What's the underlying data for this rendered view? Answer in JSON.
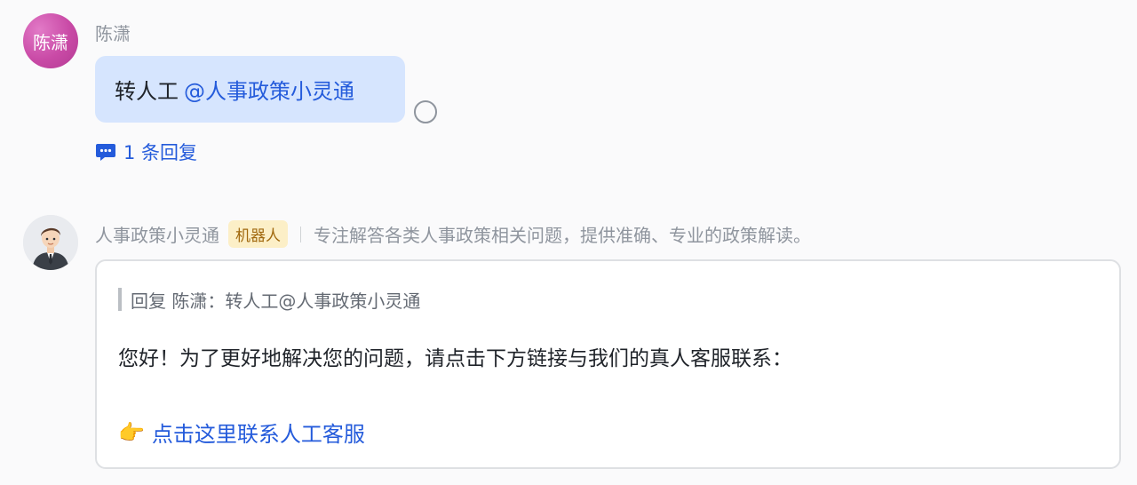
{
  "user_message": {
    "avatar_text": "陈潇",
    "sender_name": "陈潇",
    "text": "转人工",
    "mention": "@人事政策小灵通",
    "reply_count_label": "1 条回复"
  },
  "bot_message": {
    "name": "人事政策小灵通",
    "badge": "机器人",
    "description": "专注解答各类人事政策相关问题，提供准确、专业的政策解读。",
    "quote": "回复 陈潇：转人工@人事政策小灵通",
    "body": "您好！为了更好地解决您的问题，请点击下方链接与我们的真人客服联系：",
    "link_emoji": "👉",
    "link_text": "点击这里联系人工客服"
  },
  "colors": {
    "accent": "#245bdb",
    "bubble": "#d6e5fe",
    "badge_bg": "#fcefc7",
    "avatar_user": "#c94aa6"
  },
  "icons": [
    "reply-thread-icon",
    "read-status-icon",
    "pointing-hand-icon",
    "bot-avatar-icon"
  ]
}
